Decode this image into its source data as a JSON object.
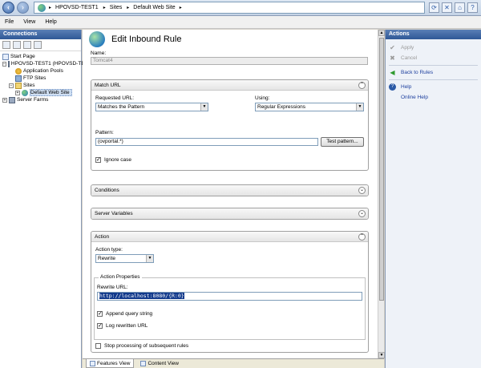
{
  "address": {
    "crumbs": [
      "HPOVSD-TEST1",
      "Sites",
      "Default Web Site"
    ]
  },
  "menu": [
    "File",
    "View",
    "Help"
  ],
  "connections": {
    "title": "Connections",
    "tree": {
      "start_page": "Start Page",
      "server": "HPOVSD-TEST1 (HPOVSD-TE",
      "app_pools": "Application Pools",
      "ftp_sites": "FTP Sites",
      "sites": "Sites",
      "default_site": "Default Web Site",
      "server_farms": "Server Farms"
    }
  },
  "editor": {
    "title": "Edit Inbound Rule",
    "name_label": "Name:",
    "name_value": "Tomcat4",
    "match_url": {
      "header": "Match URL",
      "requested_url_label": "Requested URL:",
      "requested_url_value": "Matches the Pattern",
      "using_label": "Using:",
      "using_value": "Regular Expressions",
      "pattern_label": "Pattern:",
      "pattern_value": "(ovportal.*)",
      "test_button": "Test pattern...",
      "ignore_case_label": "Ignore case",
      "ignore_case_checked": true
    },
    "conditions": {
      "header": "Conditions"
    },
    "server_variables": {
      "header": "Server Variables"
    },
    "action": {
      "header": "Action",
      "type_label": "Action type:",
      "type_value": "Rewrite",
      "properties_title": "Action Properties",
      "rewrite_url_label": "Rewrite URL:",
      "rewrite_url_value": "http://localhost:8080/{R:0}",
      "append_query_label": "Append query string",
      "append_query_checked": true,
      "log_rewritten_label": "Log rewritten URL",
      "log_rewritten_checked": true
    },
    "stop_processing_label": "Stop processing of subsequent rules",
    "stop_processing_checked": false
  },
  "bottom_tabs": [
    "Features View",
    "Content View"
  ],
  "actions": {
    "title": "Actions",
    "apply": "Apply",
    "cancel": "Cancel",
    "back_to_rules": "Back to Rules",
    "help": "Help",
    "online_help": "Online Help"
  }
}
